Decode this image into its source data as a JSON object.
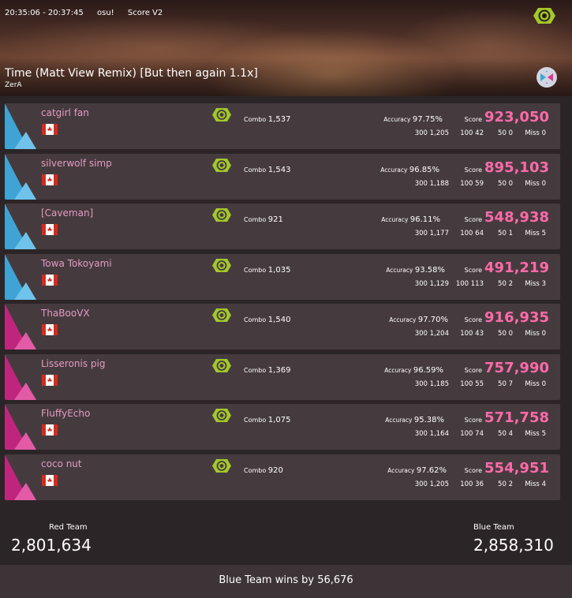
{
  "header": {
    "time_range": "20:35:06 - 20:37:45",
    "mode": "osu!",
    "scoring": "Score V2",
    "song_title": "Time (Matt View Remix) [But then again 1.1x]",
    "mapper": "ZerA",
    "mode_icon": "osu-mode-icon",
    "team_icon": "team-swap-icon"
  },
  "labels": {
    "combo": "Combo",
    "accuracy": "Accuracy",
    "score": "Score",
    "miss": "Miss"
  },
  "players": [
    {
      "team": "blue",
      "name": "catgirl fan",
      "combo": "1,537",
      "accuracy": "97.75%",
      "score": "923,050",
      "n300": "1,205",
      "n100": "42",
      "n50": "0",
      "miss": "0"
    },
    {
      "team": "blue",
      "name": "silverwolf simp",
      "combo": "1,543",
      "accuracy": "96.85%",
      "score": "895,103",
      "n300": "1,188",
      "n100": "59",
      "n50": "0",
      "miss": "0"
    },
    {
      "team": "blue",
      "name": "[Caveman]",
      "combo": "921",
      "accuracy": "96.11%",
      "score": "548,938",
      "n300": "1,177",
      "n100": "64",
      "n50": "1",
      "miss": "5"
    },
    {
      "team": "blue",
      "name": "Towa Tokoyami",
      "combo": "1,035",
      "accuracy": "93.58%",
      "score": "491,219",
      "n300": "1,129",
      "n100": "113",
      "n50": "2",
      "miss": "3"
    },
    {
      "team": "red",
      "name": "ThaBooVX",
      "combo": "1,540",
      "accuracy": "97.70%",
      "score": "916,935",
      "n300": "1,204",
      "n100": "43",
      "n50": "0",
      "miss": "0"
    },
    {
      "team": "red",
      "name": "Lisseronis pig",
      "combo": "1,369",
      "accuracy": "96.59%",
      "score": "757,990",
      "n300": "1,185",
      "n100": "55",
      "n50": "7",
      "miss": "0"
    },
    {
      "team": "red",
      "name": "FluffyEcho",
      "combo": "1,075",
      "accuracy": "95.38%",
      "score": "571,758",
      "n300": "1,164",
      "n100": "74",
      "n50": "4",
      "miss": "5"
    },
    {
      "team": "red",
      "name": "coco nut",
      "combo": "920",
      "accuracy": "97.62%",
      "score": "554,951",
      "n300": "1,205",
      "n100": "36",
      "n50": "2",
      "miss": "4"
    }
  ],
  "teams": {
    "red": {
      "label": "Red Team",
      "total": "2,801,634"
    },
    "blue": {
      "label": "Blue Team",
      "total": "2,858,310"
    }
  },
  "result": {
    "text": "Blue Team wins by",
    "margin": "56,676"
  },
  "colors": {
    "blue": "#3fa3d4",
    "red": "#c0257e",
    "score": "#ff6aa8",
    "mod": "#a3c82a"
  }
}
